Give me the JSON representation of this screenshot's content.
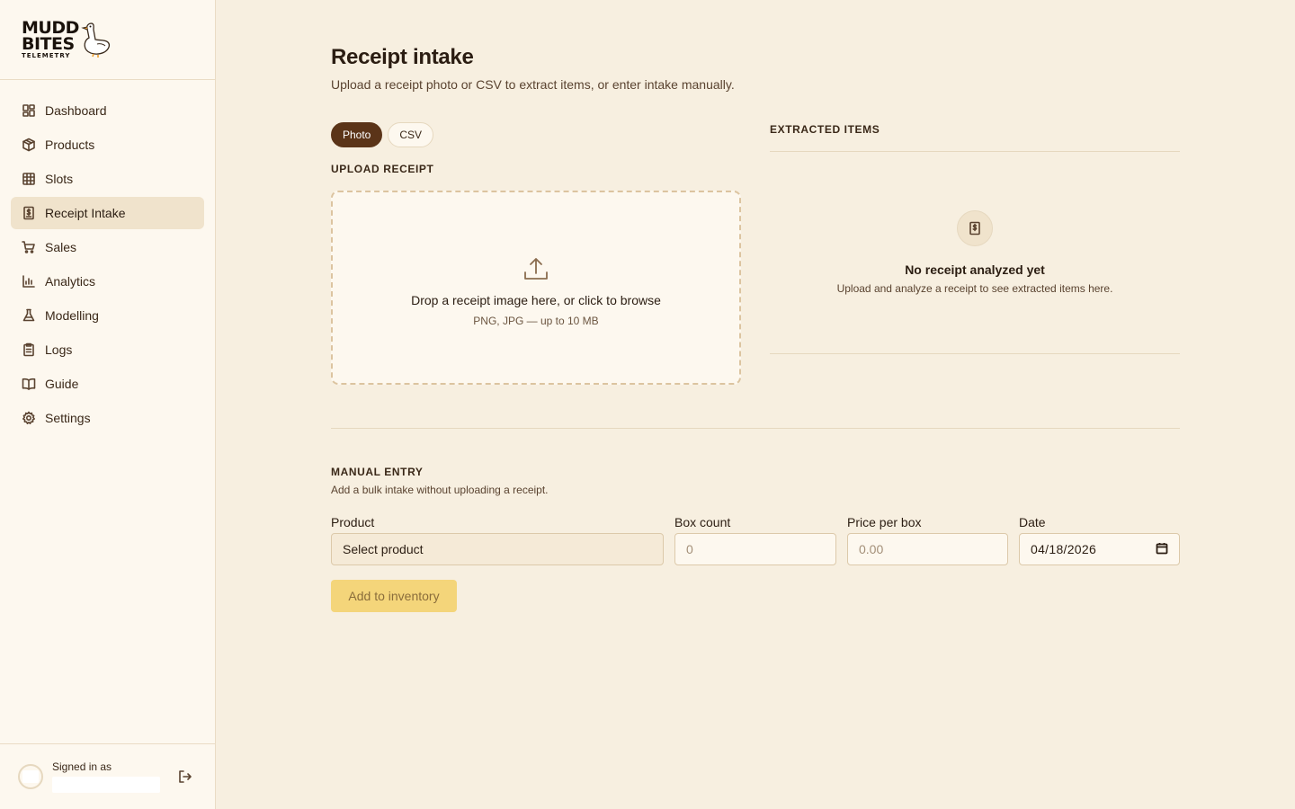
{
  "brand": {
    "line1": "MUDD",
    "line2": "BITES",
    "sub": "TELEMETRY"
  },
  "nav": {
    "items": [
      {
        "label": "Dashboard",
        "icon": "dashboard-icon"
      },
      {
        "label": "Products",
        "icon": "box-icon"
      },
      {
        "label": "Slots",
        "icon": "grid-icon"
      },
      {
        "label": "Receipt Intake",
        "icon": "receipt-icon",
        "active": true
      },
      {
        "label": "Sales",
        "icon": "cart-icon"
      },
      {
        "label": "Analytics",
        "icon": "bar-chart-icon"
      },
      {
        "label": "Modelling",
        "icon": "flask-icon"
      },
      {
        "label": "Logs",
        "icon": "clipboard-icon"
      },
      {
        "label": "Guide",
        "icon": "book-icon"
      },
      {
        "label": "Settings",
        "icon": "gear-icon"
      }
    ]
  },
  "user": {
    "signed_label": "Signed in as"
  },
  "page": {
    "title": "Receipt intake",
    "subtitle": "Upload a receipt photo or CSV to extract items, or enter intake manually."
  },
  "upload": {
    "modes": [
      "Photo",
      "CSV"
    ],
    "active_mode": "Photo",
    "label": "UPLOAD RECEIPT",
    "drop_title": "Drop a receipt image here, or click to browse",
    "drop_sub": "PNG, JPG — up to 10 MB"
  },
  "extracted": {
    "label": "EXTRACTED ITEMS",
    "empty_title": "No receipt analyzed yet",
    "empty_sub": "Upload and analyze a receipt to see extracted items here."
  },
  "manual": {
    "label": "MANUAL ENTRY",
    "sub": "Add a bulk intake without uploading a receipt.",
    "product_label": "Product",
    "product_value": "Select product",
    "box_label": "Box count",
    "box_placeholder": "0",
    "price_label": "Price per box",
    "price_placeholder": "0.00",
    "date_label": "Date",
    "date_value": "04/18/2026",
    "submit_label": "Add to inventory"
  },
  "colors": {
    "accent": "#5b3418",
    "button": "#f4d57a",
    "background": "#f7efe0",
    "sidebar": "#fdf8ef"
  }
}
